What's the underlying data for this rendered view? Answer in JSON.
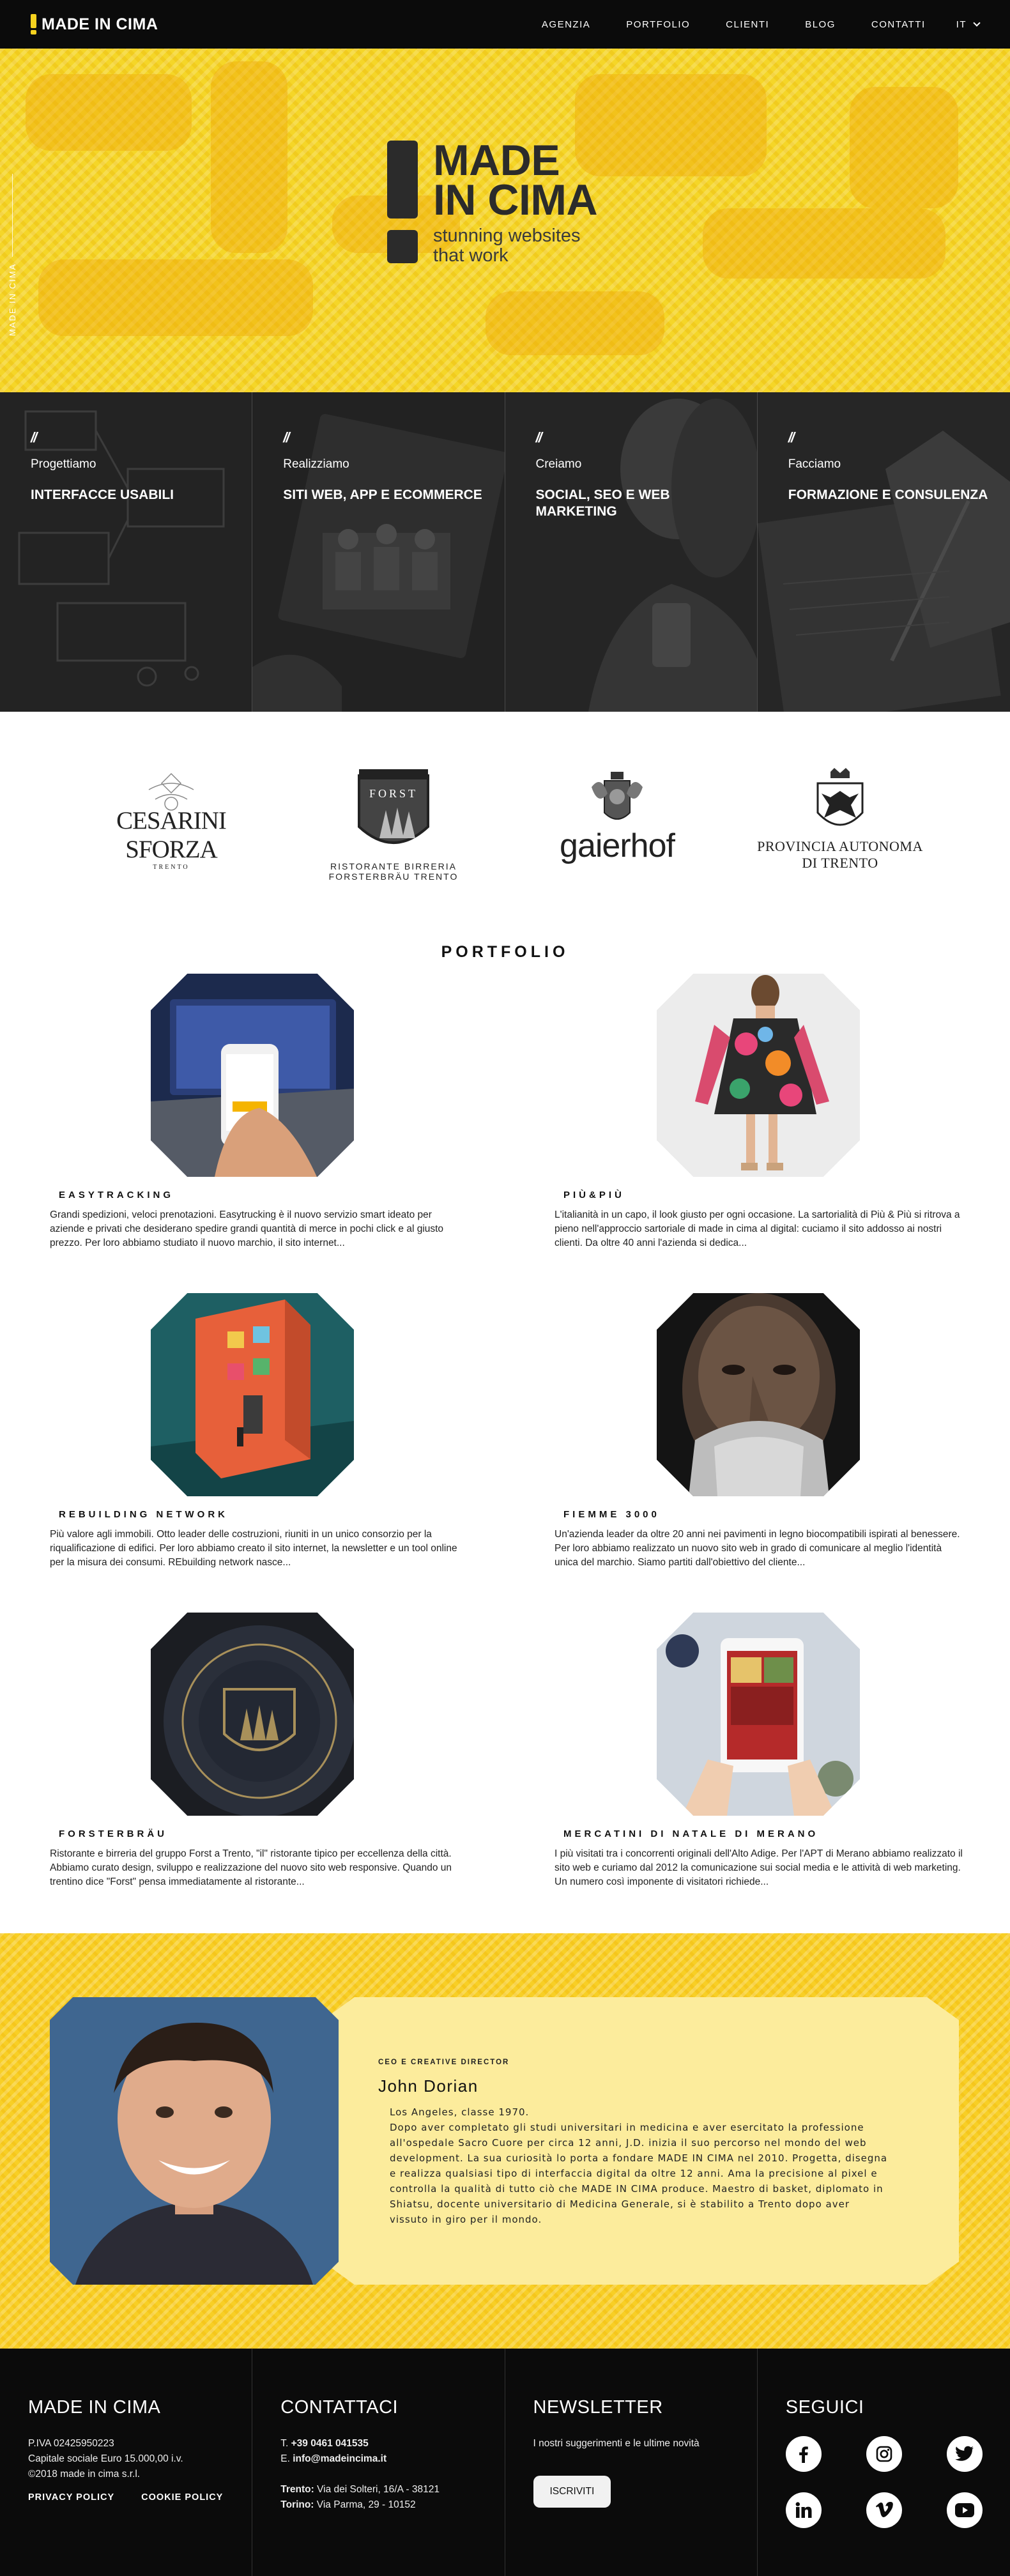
{
  "nav": {
    "brand": "MADE IN CIMA",
    "menu": [
      "AGENZIA",
      "PORTFOLIO",
      "CLIENTI",
      "BLOG",
      "CONTATTI"
    ],
    "lang": "IT"
  },
  "hero": {
    "side_text": "MADE IN CIMA",
    "logo_line1": "MADE",
    "logo_line2": "IN CIMA",
    "tagline_1": "stunning websites",
    "tagline_2": "that work",
    "accent": "#f5d628"
  },
  "services": [
    {
      "slash": "//",
      "kicker": "Progettiamo",
      "title": "INTERFACCE USABILI"
    },
    {
      "slash": "//",
      "kicker": "Realizziamo",
      "title": "SITI WEB, APP E ECOMMERCE"
    },
    {
      "slash": "//",
      "kicker": "Creiamo",
      "title": "SOCIAL, SEO E WEB MARKETING"
    },
    {
      "slash": "//",
      "kicker": "Facciamo",
      "title": "FORMAZIONE E CONSULENZA"
    }
  ],
  "clients": {
    "cesarini_1": "CESARINI SFORZA",
    "cesarini_2": "TRENTO",
    "forst_shield": "FORST",
    "forst_1": "RISTORANTE BIRRERIA",
    "forst_2": "FORSTERBRÄU TRENTO",
    "gaierhof": "gaierhof",
    "provincia_1": "PROVINCIA AUTONOMA",
    "provincia_2": "DI TRENTO"
  },
  "portfolio": {
    "title": "PORTFOLIO",
    "items": [
      {
        "name": "EASYTRACKING",
        "desc": "Grandi spedizioni, veloci prenotazioni. Easytrucking è il nuovo servizio smart ideato per aziende e privati che desiderano spedire grandi quantità di merce in pochi click e al giusto prezzo. Per loro abbiamo studiato il nuovo marchio, il sito internet..."
      },
      {
        "name": "PIÙ&PIÙ",
        "desc": "L'italianità in un capo, il look giusto per ogni occasione. La sartorialità di Più & Più si ritrova a pieno nell'approccio sartoriale di made in cima al digital: cuciamo il sito addosso ai nostri clienti. Da oltre 40 anni l'azienda si dedica..."
      },
      {
        "name": "REBUILDING NETWORK",
        "desc": "Più valore agli immobili. Otto leader delle costruzioni, riuniti in un unico consorzio per la riqualificazione di edifici. Per loro abbiamo creato il sito internet, la newsletter e un tool online per la misura dei consumi. REbuilding network nasce..."
      },
      {
        "name": "FIEMME 3000",
        "desc": "Un'azienda leader da oltre 20 anni nei pavimenti in legno biocompatibili ispirati al benessere. Per loro abbiamo realizzato un nuovo sito web in grado di comunicare al meglio l'identità unica del marchio. Siamo partiti dall'obiettivo del cliente..."
      },
      {
        "name": "FORSTERBRÄU",
        "desc": "Ristorante e birreria del gruppo Forst a Trento, \"il\" ristorante tipico per eccellenza della città. Abbiamo curato design, sviluppo e realizzazione del nuovo sito web responsive. Quando un trentino dice \"Forst\" pensa immediatamente al ristorante..."
      },
      {
        "name": "MERCATINI DI NATALE DI MERANO",
        "desc": "I più visitati tra i concorrenti originali dell'Alto Adige. Per l'APT di Merano abbiamo realizzato il sito web e curiamo dal 2012 la comunicazione sui social media e le attività di web marketing. Un numero così imponente di visitatori richiede..."
      }
    ]
  },
  "team": {
    "role": "CEO E CREATIVE DIRECTOR",
    "name": "John Dorian",
    "bio_line1": "Los Angeles, classe 1970.",
    "bio_rest": "Dopo aver completato gli studi universitari in medicina e aver esercitato la professione all'ospedale Sacro Cuore per circa 12 anni, J.D. inizia il suo percorso nel mondo del web development. La sua curiosità lo porta a fondare MADE IN CIMA nel 2010. Progetta, disegna e realizza qualsiasi tipo di interfaccia digital da oltre 12 anni. Ama la precisione al pixel e controlla la qualità di tutto ciò che MADE IN CIMA produce. Maestro di basket, diplomato in Shiatsu, docente universitario di Medicina Generale, si è stabilito a Trento dopo aver vissuto in giro per il mondo."
  },
  "footer": {
    "col1": {
      "title": "MADE IN CIMA",
      "line1": "P.IVA 02425950223",
      "line2": "Capitale sociale Euro 15.000,00 i.v.",
      "line3": "©2018 made in cima s.r.l.",
      "privacy": "PRIVACY POLICY",
      "cookie": "COOKIE POLICY"
    },
    "col2": {
      "title": "CONTATTACI",
      "tel_label": "T.",
      "tel": "+39 0461 041535",
      "email_label": "E.",
      "email": "info@madeincima.it",
      "addr1_city": "Trento:",
      "addr1": "Via dei Solteri, 16/A - 38121",
      "addr2_city": "Torino:",
      "addr2": "Via Parma, 29 - 10152"
    },
    "col3": {
      "title": "NEWSLETTER",
      "text": "I nostri suggerimenti e le ultime novità",
      "button": "ISCRIVITI"
    },
    "col4": {
      "title": "SEGUICI",
      "icons": [
        "facebook-icon",
        "instagram-icon",
        "twitter-icon",
        "linkedin-icon",
        "vimeo-icon",
        "youtube-icon"
      ]
    }
  }
}
